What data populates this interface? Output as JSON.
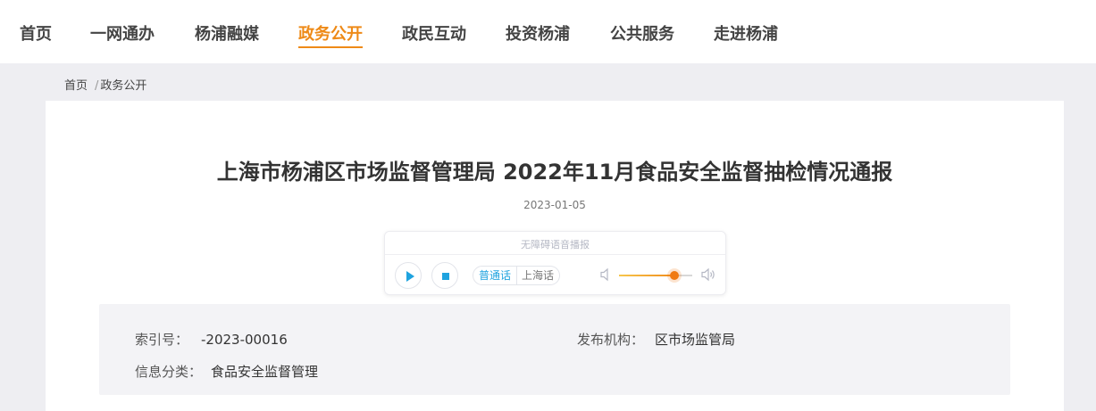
{
  "nav": {
    "items": [
      {
        "label": "首页",
        "active": false
      },
      {
        "label": "一网通办",
        "active": false
      },
      {
        "label": "杨浦融媒",
        "active": false
      },
      {
        "label": "政务公开",
        "active": true
      },
      {
        "label": "政民互动",
        "active": false
      },
      {
        "label": "投资杨浦",
        "active": false
      },
      {
        "label": "公共服务",
        "active": false
      },
      {
        "label": "走进杨浦",
        "active": false
      }
    ]
  },
  "breadcrumb": {
    "items": [
      "首页",
      "政务公开"
    ],
    "separator": "/"
  },
  "article": {
    "title": "上海市杨浦区市场监督管理局 2022年11月食品安全监督抽检情况通报",
    "date": "2023-01-05"
  },
  "player": {
    "label": "无障碍语音播报",
    "languages": [
      "普通话",
      "上海话"
    ],
    "selected_language": "普通话",
    "volume": 0.75,
    "icons": {
      "play": "play-icon",
      "stop": "stop-icon",
      "vol_low": "volume-low-icon",
      "vol_high": "volume-high-icon"
    }
  },
  "meta": {
    "index_label": "索引号：",
    "index_value": "-2023-00016",
    "publisher_label": "发布机构：",
    "publisher_value": "区市场监管局",
    "category_label": "信息分类：",
    "category_value": "食品安全监督管理"
  },
  "colors": {
    "accent": "#ee8a17",
    "player_blue": "#1fa3df",
    "page_bg": "#eeeef2"
  }
}
